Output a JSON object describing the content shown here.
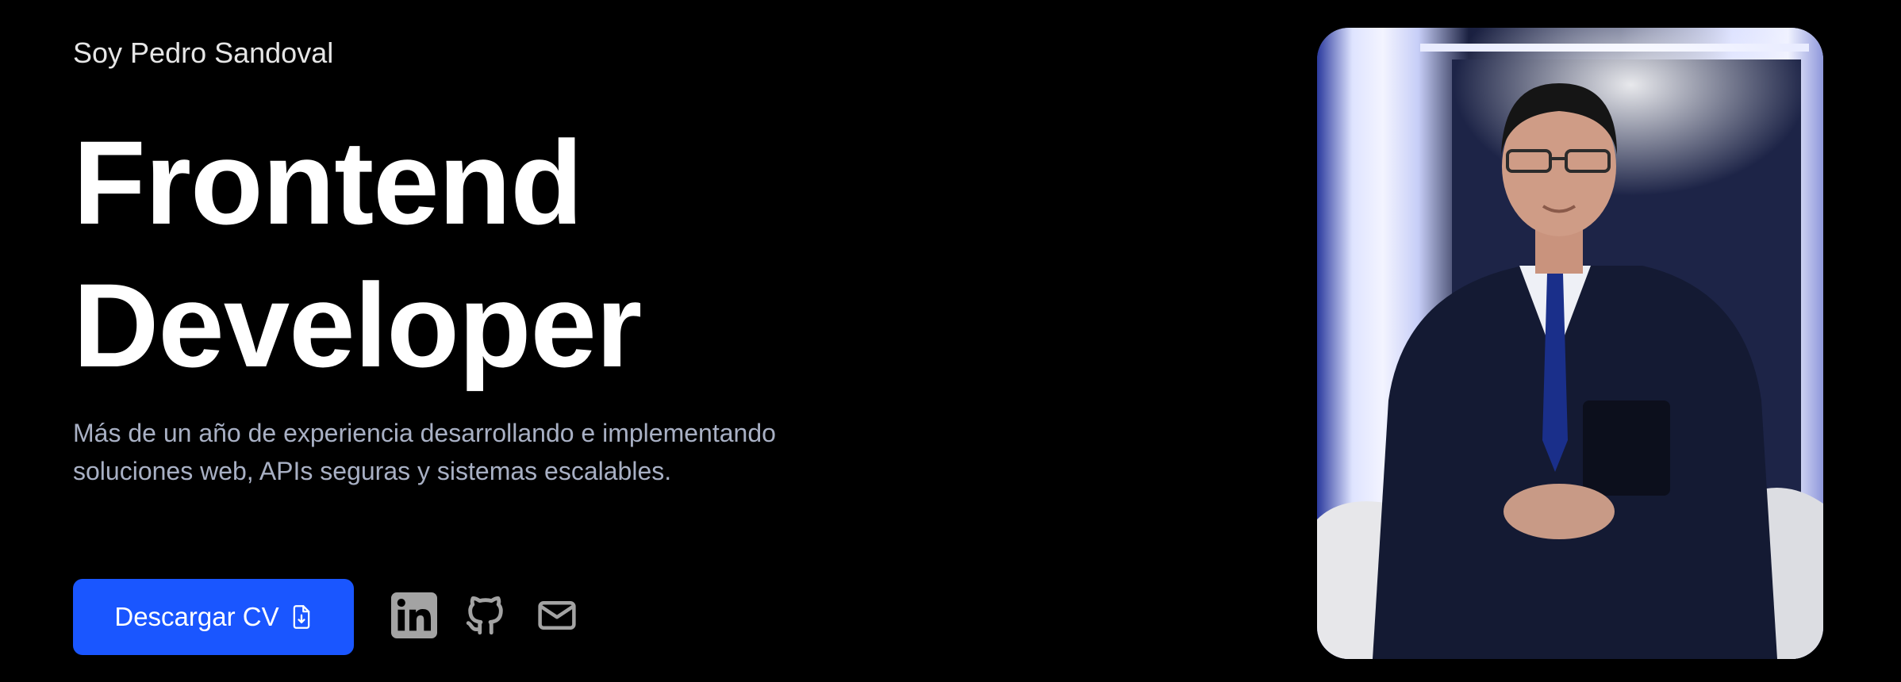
{
  "hero": {
    "eyebrow": "Soy Pedro Sandoval",
    "headline_line1": "Frontend",
    "headline_line2": "Developer",
    "description": "Más de un año de experiencia desarrollando e implementando soluciones web, APIs seguras y sistemas escalables."
  },
  "cta": {
    "label": "Descargar CV",
    "icon": "file-download-icon"
  },
  "socials": [
    {
      "name": "LinkedIn",
      "icon": "linkedin-icon"
    },
    {
      "name": "GitHub",
      "icon": "github-icon"
    },
    {
      "name": "Email",
      "icon": "mail-icon"
    }
  ],
  "colors": {
    "background": "#000000",
    "accent": "#1a56ff",
    "text": "#ffffff",
    "muted_text": "#a8b0c4",
    "icon": "#a3a3a3"
  }
}
